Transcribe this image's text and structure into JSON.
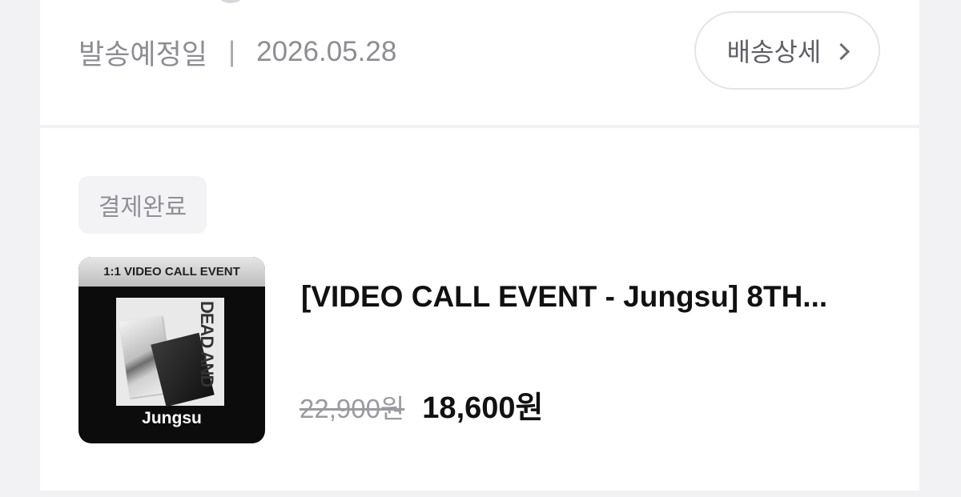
{
  "shipping": {
    "label": "발송예정일",
    "separator": "|",
    "date": "2026.05.28",
    "detail_button": "배송상세"
  },
  "order": {
    "status": "결제완료",
    "product": {
      "thumbnail_header": "1:1 VIDEO CALL EVENT",
      "thumbnail_artist": "Jungsu",
      "album_cover_text": "DEAD AND",
      "title": "[VIDEO CALL EVENT - Jungsu] 8TH...",
      "original_price": "22,900원",
      "sale_price": "18,600원"
    }
  }
}
